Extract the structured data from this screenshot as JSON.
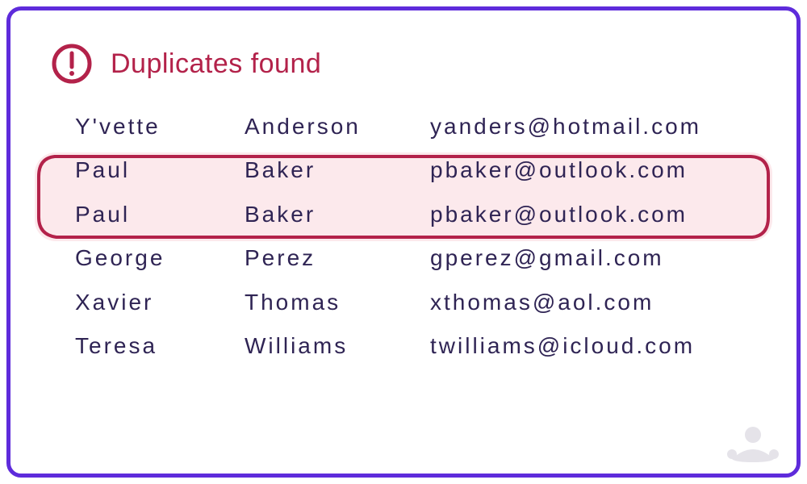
{
  "alert": {
    "title": "Duplicates found"
  },
  "table": {
    "rows": [
      {
        "first": "Y'vette",
        "last": "Anderson",
        "email": "yanders@hotmail.com",
        "dup": false
      },
      {
        "first": "Paul",
        "last": "Baker",
        "email": "pbaker@outlook.com",
        "dup": true
      },
      {
        "first": "Paul",
        "last": "Baker",
        "email": "pbaker@outlook.com",
        "dup": true
      },
      {
        "first": "George",
        "last": "Perez",
        "email": "gperez@gmail.com",
        "dup": false
      },
      {
        "first": "Xavier",
        "last": "Thomas",
        "email": "xthomas@aol.com",
        "dup": false
      },
      {
        "first": "Teresa",
        "last": "Williams",
        "email": "twilliams@icloud.com",
        "dup": false
      }
    ]
  },
  "colors": {
    "accent": "#5e2bdb",
    "alert": "#b3224a",
    "text": "#2f2454",
    "highlight_fill": "#fce9ec"
  }
}
